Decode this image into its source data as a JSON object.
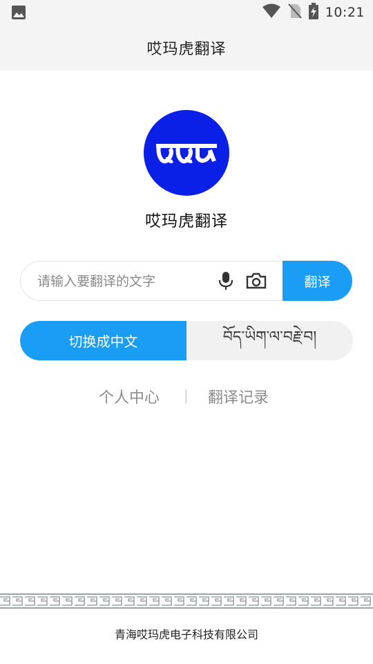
{
  "status_bar": {
    "time": "10:21",
    "icons": [
      "gallery-icon",
      "wifi-icon",
      "no-sim-icon",
      "battery-charging-icon"
    ]
  },
  "app_bar": {
    "title": "哎玛虎翻译"
  },
  "logo": {
    "name": "tibetan-logo",
    "color": "#0b20e6"
  },
  "app_name": "哎玛虎翻译",
  "search": {
    "placeholder": "请输入要翻译的文字",
    "value": "",
    "mic_icon": "microphone-icon",
    "camera_icon": "camera-icon",
    "translate_label": "翻译"
  },
  "toggle": {
    "chinese_label": "切换成中文",
    "tibetan_label": "བོད་ཡིག་ལ་བརྗེ་བ།",
    "active": "chinese"
  },
  "links": {
    "profile_label": "个人中心",
    "separator": "|",
    "history_label": "翻译记录"
  },
  "footer": {
    "company": "青海哎玛虎电子科技有限公司"
  },
  "colors": {
    "accent": "#1a9ef5",
    "logo_bg": "#0b20e6",
    "bar_bg": "#f4f4f4"
  }
}
